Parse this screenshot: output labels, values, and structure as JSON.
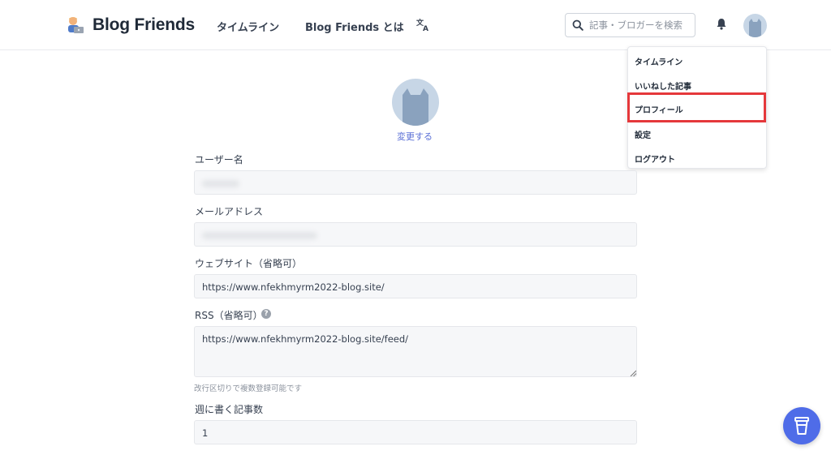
{
  "header": {
    "brand": "Blog Friends",
    "nav": {
      "timeline": "タイムライン",
      "about": "Blog Friends とは"
    },
    "search_placeholder": "記事・ブロガーを検索"
  },
  "dropdown": {
    "items": [
      "タイムライン",
      "いいねした記事",
      "プロフィール",
      "設定",
      "ログアウト"
    ],
    "highlighted": "プロフィール"
  },
  "profile": {
    "change_label": "変更する",
    "fields": {
      "username_label": "ユーザー名",
      "email_label": "メールアドレス",
      "website_label": "ウェブサイト（省略可）",
      "website_value": "https://www.nfekhmyrm2022-blog.site/",
      "rss_label": "RSS（省略可）",
      "rss_value": "https://www.nfekhmyrm2022-blog.site/feed/",
      "rss_hint": "改行区切りで複数登録可能です",
      "weekly_label": "週に書く記事数",
      "weekly_value": "1"
    }
  },
  "colors": {
    "accent": "#5a6fd6",
    "fab": "#4f6ce8",
    "highlight": "#e5383b"
  },
  "icons": [
    "logo-icon",
    "translate-icon",
    "search-icon",
    "bell-icon",
    "avatar-cat-icon",
    "help-icon",
    "coffee-cup-icon"
  ]
}
